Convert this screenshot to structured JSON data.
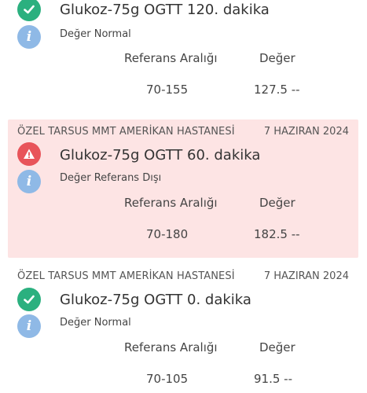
{
  "results": [
    {
      "hospital": "",
      "date": "",
      "test_name": "Glukoz-75g OGTT 120. dakika",
      "status_label": "Değer Normal",
      "status": "normal",
      "ref_header": "Referans Aralığı",
      "value_header": "Değer",
      "ref_range": "70-155",
      "value": "127.5 --"
    },
    {
      "hospital": "ÖZEL TARSUS MMT AMERİKAN HASTANESİ",
      "date": "7 HAZIRAN 2024",
      "test_name": "Glukoz-75g OGTT 60. dakika",
      "status_label": "Değer Referans Dışı",
      "status": "abnormal",
      "ref_header": "Referans Aralığı",
      "value_header": "Değer",
      "ref_range": "70-180",
      "value": "182.5 --"
    },
    {
      "hospital": "ÖZEL TARSUS MMT AMERİKAN HASTANESİ",
      "date": "7 HAZIRAN 2024",
      "test_name": "Glukoz-75g OGTT 0. dakika",
      "status_label": "Değer Normal",
      "status": "normal",
      "ref_header": "Referans Aralığı",
      "value_header": "Değer",
      "ref_range": "70-105",
      "value": "91.5 --"
    }
  ],
  "colors": {
    "normal_icon": "#2bb07f",
    "warning_icon": "#e8545a",
    "info_icon": "#8fb9e6",
    "abnormal_background": "#fde4e4"
  },
  "icons": {
    "normal": "check-circle-icon",
    "abnormal": "warning-triangle-icon",
    "info": "info-icon"
  }
}
